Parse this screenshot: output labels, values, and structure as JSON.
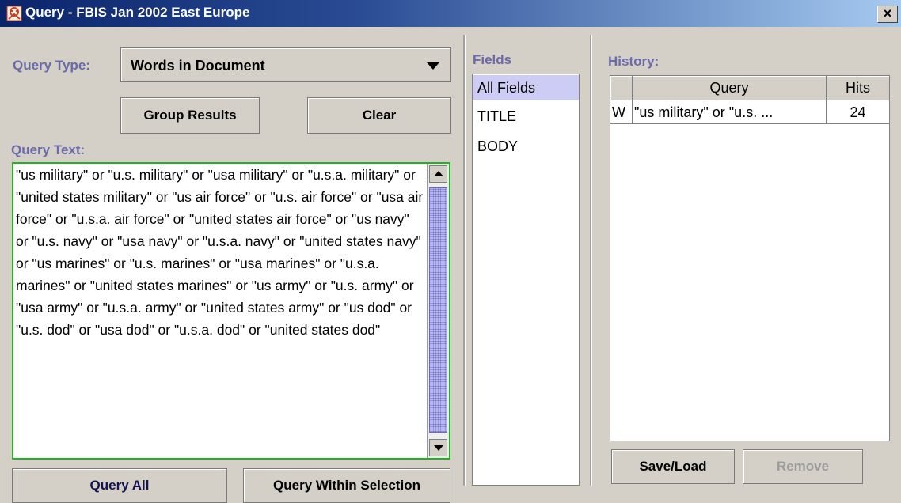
{
  "window": {
    "title": "Query - FBIS Jan 2002 East Europe",
    "close_label": "×"
  },
  "query_type": {
    "label": "Query Type:",
    "selected": "Words in Document"
  },
  "buttons": {
    "group_results": "Group Results",
    "clear": "Clear",
    "query_all": "Query All",
    "query_within_selection": "Query Within Selection",
    "save_load": "Save/Load",
    "remove": "Remove"
  },
  "query_text": {
    "label": "Query Text:",
    "value": "\"us military\" or \"u.s. military\" or \"usa military\" or \"u.s.a. military\" or \"united states military\" or \"us air force\" or \"u.s. air force\" or \"usa air force\" or \"u.s.a. air force\" or \"united states air force\" or \"us navy\" or \"u.s. navy\" or \"usa navy\" or \"u.s.a. navy\" or \"united states navy\" or \"us marines\" or \"u.s. marines\" or \"usa marines\" or \"u.s.a. marines\" or \"united states marines\" or \"us army\" or \"u.s. army\" or \"usa army\" or \"u.s.a. army\" or \"united states army\" or \"us dod\" or \"u.s. dod\" or \"usa dod\" or \"u.s.a. dod\" or \"united states dod\""
  },
  "fields": {
    "label": "Fields",
    "items": [
      "All Fields",
      "TITLE",
      "BODY"
    ],
    "selected": "All Fields"
  },
  "history": {
    "label": "History:",
    "columns": [
      "",
      "Query",
      "Hits"
    ],
    "rows": [
      {
        "type": "W",
        "query": "\"us military\" or \"u.s. ...",
        "hits": "24"
      }
    ]
  },
  "colors": {
    "label_color": "#6a6aa8",
    "titlebar_dark": "#0a246a",
    "selection": "#ccccf5",
    "focus_border": "#22b222"
  },
  "icons": [
    "app-icon",
    "close-icon",
    "dropdown-arrow-icon",
    "scroll-up-icon",
    "scroll-down-icon"
  ]
}
